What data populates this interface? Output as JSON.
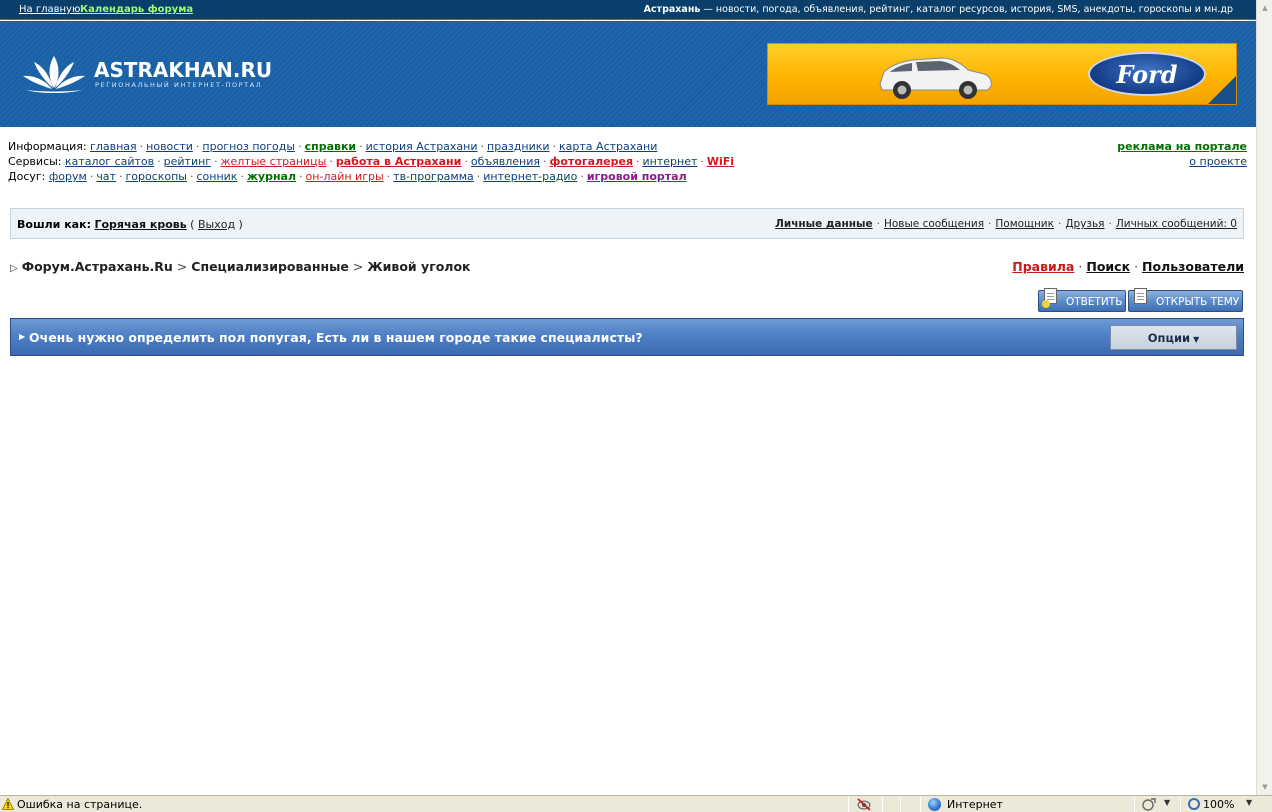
{
  "top_strip": {
    "home_link": "На главную",
    "calendar_link": "Календарь форума",
    "site_name": "Астрахань",
    "site_tagline": " — новости, погода, объявления, рейтинг, каталог ресурсов, история, SMS, анекдоты, гороскопы и мн.др"
  },
  "header": {
    "logo_title": "ASTRAKHAN.RU",
    "logo_subtitle": "РЕГИОНАЛЬНЫЙ ИНТЕРНЕТ-ПОРТАЛ",
    "banner_brand": "Ford",
    "colors": {
      "header_blue": "#1a5fa3",
      "banner_yellow": "#ffb400",
      "ford_blue": "#163f8a"
    }
  },
  "nav": {
    "info": {
      "label": "Информация:",
      "links": [
        "главная",
        "новости",
        "прогноз погоды",
        "справки",
        "история Астрахани",
        "праздники",
        "карта Астрахани"
      ]
    },
    "services": {
      "label": "Сервисы:",
      "links": [
        "каталог сайтов",
        "рейтинг",
        "желтые страницы",
        "работа в Астрахани",
        "объявления",
        "фотогалерея",
        "интернет",
        "WiFi"
      ]
    },
    "leisure": {
      "label": "Досуг:",
      "links": [
        "форум",
        "чат",
        "гороскопы",
        "сонник",
        "журнал",
        "он-лайн игры",
        "тв-программа",
        "интернет-радио",
        "игровой портал"
      ]
    },
    "ad_link": "реклама на портале",
    "about_link": "о проекте"
  },
  "userbar": {
    "logged_as_label": "Вошли как:",
    "username": "Горячая кровь",
    "logout": "Выход",
    "links": [
      "Личные данные",
      "Новые сообщения",
      "Помощник",
      "Друзья",
      "Личных сообщений: 0"
    ]
  },
  "breadcrumb": {
    "items": [
      "Форум.Астрахань.Ru",
      "Специализированные",
      "Живой уголок"
    ],
    "links": [
      "Правила",
      "Поиск",
      "Пользователи"
    ]
  },
  "buttons": {
    "reply": "ОТВЕТИТЬ",
    "new_topic": "ОТКРЫТЬ ТЕМУ"
  },
  "thread": {
    "title": "Очень нужно определить пол попугая, Есть ли в нашем городе такие специалисты?",
    "options_label": "Опции"
  },
  "status_bar": {
    "message": "Ошибка на странице.",
    "zone": "Интернет",
    "zoom": "100%"
  }
}
